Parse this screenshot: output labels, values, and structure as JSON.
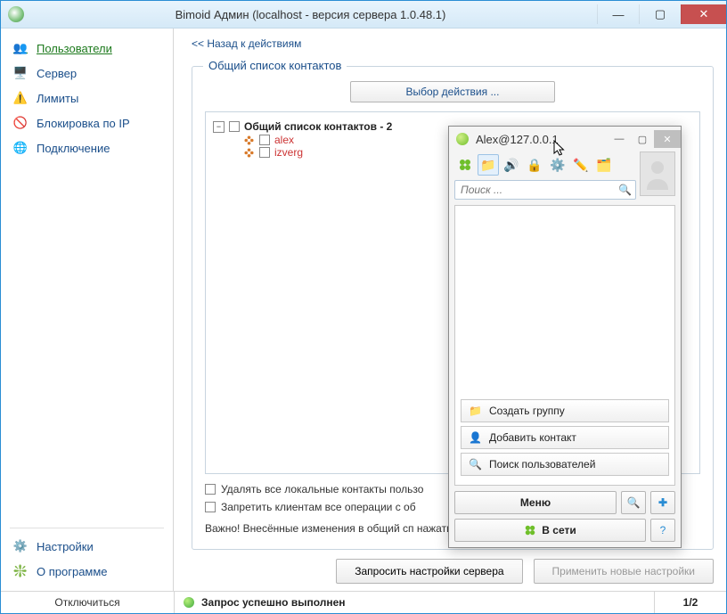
{
  "window": {
    "title": "Bimoid Админ (localhost - версия сервера 1.0.48.1)"
  },
  "sidebar": {
    "items": [
      {
        "label": "Пользователи"
      },
      {
        "label": "Сервер"
      },
      {
        "label": "Лимиты"
      },
      {
        "label": "Блокировка по IP"
      },
      {
        "label": "Подключение"
      }
    ],
    "bottom": [
      {
        "label": "Настройки"
      },
      {
        "label": "О программе"
      }
    ]
  },
  "main": {
    "back_link": "<< Назад к действиям",
    "group_title": "Общий список контактов",
    "action_button": "Выбор действия ...",
    "tree": {
      "root_label": "Общий список контактов - 2",
      "children": [
        {
          "label": "alex"
        },
        {
          "label": "izverg"
        }
      ]
    },
    "checks": [
      "Удалять все локальные контакты пользо",
      "Запретить клиентам все операции с об"
    ],
    "note": "Важно! Внесённые изменения в общий сп\nнажатия на кнопку \"Применить новые нас",
    "buttons": {
      "request": "Запросить настройки сервера",
      "apply": "Применить новые настройки"
    }
  },
  "status": {
    "disconnect": "Отключиться",
    "message": "Запрос успешно выполнен",
    "page": "1/2"
  },
  "client": {
    "title": "Alex@127.0.0.1",
    "search_placeholder": "Поиск ...",
    "actions": [
      {
        "label": "Создать группу"
      },
      {
        "label": "Добавить контакт"
      },
      {
        "label": "Поиск пользователей"
      }
    ],
    "menu_label": "Меню",
    "status_label": "В сети"
  }
}
